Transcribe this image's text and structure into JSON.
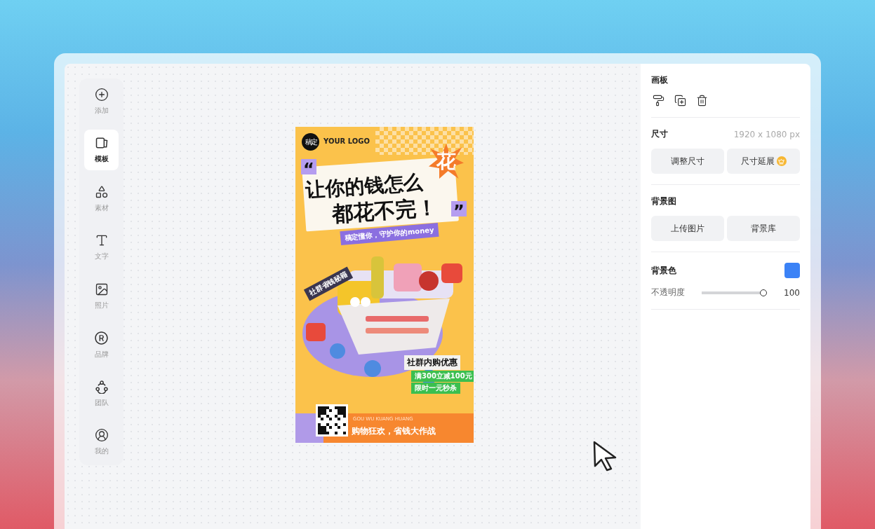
{
  "toolbar": [
    {
      "label": "添加",
      "selected": false
    },
    {
      "label": "模板",
      "selected": true
    },
    {
      "label": "素材",
      "selected": false
    },
    {
      "label": "文字",
      "selected": false
    },
    {
      "label": "照片",
      "selected": false
    },
    {
      "label": "品牌",
      "selected": false
    },
    {
      "label": "团队",
      "selected": false
    },
    {
      "label": "我的",
      "selected": false
    }
  ],
  "poster": {
    "logo_mark": "稿定",
    "logo_text": "YOUR LOGO",
    "open_quote": "“",
    "headline_1": "让你的钱怎么",
    "burst": "花",
    "headline_2": "都花不完！",
    "close_quote": "”",
    "subtitle": "稿定懂你，守护你的money",
    "tag": "社群省钱秘籍",
    "offer_title": "社群内购优惠",
    "offers": [
      "满300立减100元",
      "限时一元秒杀"
    ],
    "footer_pinyin": "GOU WU KUANG HUANG",
    "footer_title": "购物狂欢，省钱大作战"
  },
  "panel": {
    "artboard": {
      "title": "画板"
    },
    "size": {
      "title": "尺寸",
      "value": "1920 x 1080 px",
      "buttons": [
        {
          "label": "调整尺寸",
          "premium": false
        },
        {
          "label": "尺寸延展",
          "premium": true
        }
      ]
    },
    "background_image": {
      "title": "背景图",
      "buttons": [
        {
          "label": "上传图片",
          "premium": false
        },
        {
          "label": "背景库",
          "premium": false
        }
      ]
    },
    "background_color": {
      "title": "背景色",
      "color": "#3b82f6",
      "opacity_label": "不透明度",
      "level": 1,
      "reading": "100"
    }
  }
}
